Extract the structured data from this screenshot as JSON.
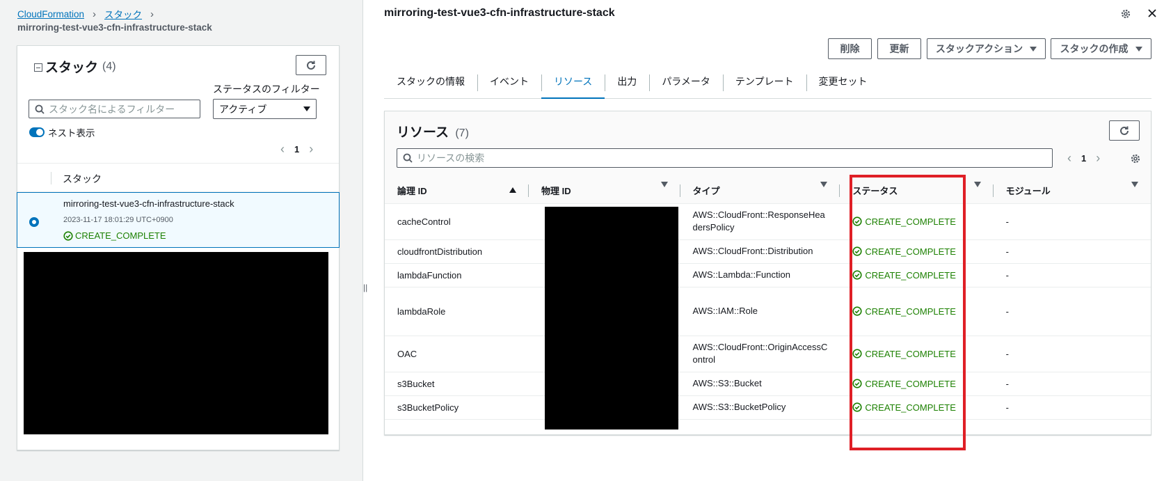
{
  "breadcrumb": {
    "root": "CloudFormation",
    "section": "スタック",
    "current": "mirroring-test-vue3-cfn-infrastructure-stack"
  },
  "stacks_panel": {
    "title": "スタック",
    "count": "(4)",
    "status_filter_label": "ステータスのフィルター",
    "status_filter_value": "アクティブ",
    "search_placeholder": "スタック名によるフィルター",
    "nested_label": "ネスト表示",
    "page": "1",
    "column_header": "スタック",
    "selected": {
      "name": "mirroring-test-vue3-cfn-infrastructure-stack",
      "timestamp": "2023-11-17 18:01:29 UTC+0900",
      "status": "CREATE_COMPLETE"
    }
  },
  "detail": {
    "title": "mirroring-test-vue3-cfn-infrastructure-stack",
    "buttons": {
      "delete": "削除",
      "update": "更新",
      "stack_actions": "スタックアクション",
      "create_stack": "スタックの作成"
    },
    "tabs": [
      "スタックの情報",
      "イベント",
      "リソース",
      "出力",
      "パラメータ",
      "テンプレート",
      "変更セット"
    ],
    "active_tab": "リソース"
  },
  "resources": {
    "title": "リソース",
    "count": "(7)",
    "search_placeholder": "リソースの検索",
    "page": "1",
    "columns": [
      "論理 ID",
      "物理 ID",
      "タイプ",
      "ステータス",
      "モジュール"
    ],
    "rows": [
      {
        "logical_id": "cacheControl",
        "type": "AWS::CloudFront::ResponseHea dersPolicy",
        "status": "CREATE_COMPLETE",
        "module": "-"
      },
      {
        "logical_id": "cloudfrontDistribution",
        "type": "AWS::CloudFront::Distribution",
        "status": "CREATE_COMPLETE",
        "module": "-"
      },
      {
        "logical_id": "lambdaFunction",
        "type": "AWS::Lambda::Function",
        "status": "CREATE_COMPLETE",
        "module": "-"
      },
      {
        "logical_id": "lambdaRole",
        "type": "AWS::IAM::Role",
        "status": "CREATE_COMPLETE",
        "module": "-"
      },
      {
        "logical_id": "OAC",
        "type": "AWS::CloudFront::OriginAccessC ontrol",
        "status": "CREATE_COMPLETE",
        "module": "-"
      },
      {
        "logical_id": "s3Bucket",
        "type": "AWS::S3::Bucket",
        "status": "CREATE_COMPLETE",
        "module": "-"
      },
      {
        "logical_id": "s3BucketPolicy",
        "type": "AWS::S3::BucketPolicy",
        "status": "CREATE_COMPLETE",
        "module": "-"
      }
    ]
  },
  "colors": {
    "link": "#0073bb",
    "success": "#1d8102",
    "highlight": "#df1f26"
  }
}
